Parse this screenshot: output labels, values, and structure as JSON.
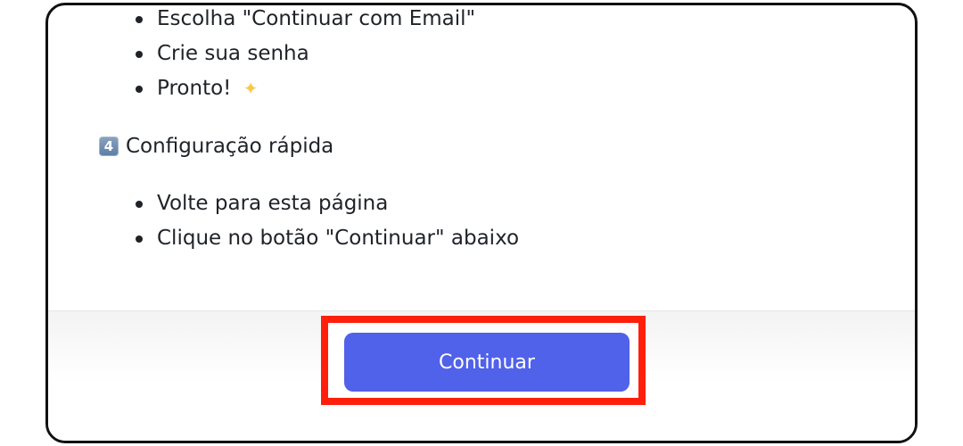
{
  "steps_top": [
    "Escolha \"Continuar com Email\"",
    "Crie sua senha",
    "Pronto!"
  ],
  "sparkle_icon": "sparkles-icon",
  "section": {
    "number_icon": "keycap-4-icon",
    "number": "4",
    "title": "Configuração rápida"
  },
  "steps_bottom": [
    "Volte para esta página",
    "Clique no botão \"Continuar\" abaixo"
  ],
  "footer": {
    "continue_label": "Continuar"
  },
  "colors": {
    "button": "#5061ea",
    "highlight": "#ff1f0a"
  }
}
